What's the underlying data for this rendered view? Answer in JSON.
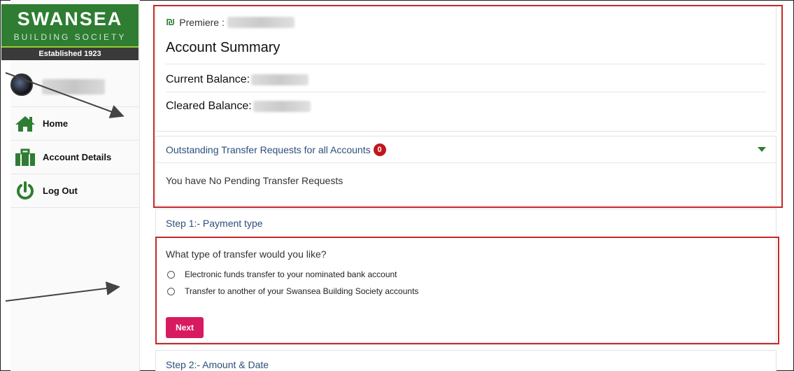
{
  "brand": {
    "name": "SWANSEA",
    "subtitle": "BUILDING SOCIETY",
    "established": "Established 1923"
  },
  "sidebar": {
    "items": [
      {
        "label": "Home",
        "icon": "home-icon"
      },
      {
        "label": "Account Details",
        "icon": "briefcase-icon"
      },
      {
        "label": "Log Out",
        "icon": "power-icon"
      }
    ]
  },
  "account": {
    "premiere_label": "Premiere :",
    "title": "Account Summary",
    "current_balance_label": "Current Balance:",
    "cleared_balance_label": "Cleared Balance:"
  },
  "transfers": {
    "header": "Outstanding Transfer Requests for all Accounts",
    "count": "0",
    "empty_message": "You have No Pending Transfer Requests"
  },
  "step1": {
    "title": "Step 1:- Payment type",
    "question": "What type of transfer would you like?",
    "options": [
      "Electronic funds transfer to your nominated bank account",
      "Transfer to another of your Swansea Building Society accounts"
    ],
    "next_label": "Next"
  },
  "step2": {
    "title": "Step 2:- Amount & Date"
  },
  "colors": {
    "brand_green": "#2e7d32",
    "accent_pink": "#d81b60",
    "badge_red": "#c0171d",
    "highlight_red": "#c62828",
    "link_blue": "#2c4f7a"
  }
}
